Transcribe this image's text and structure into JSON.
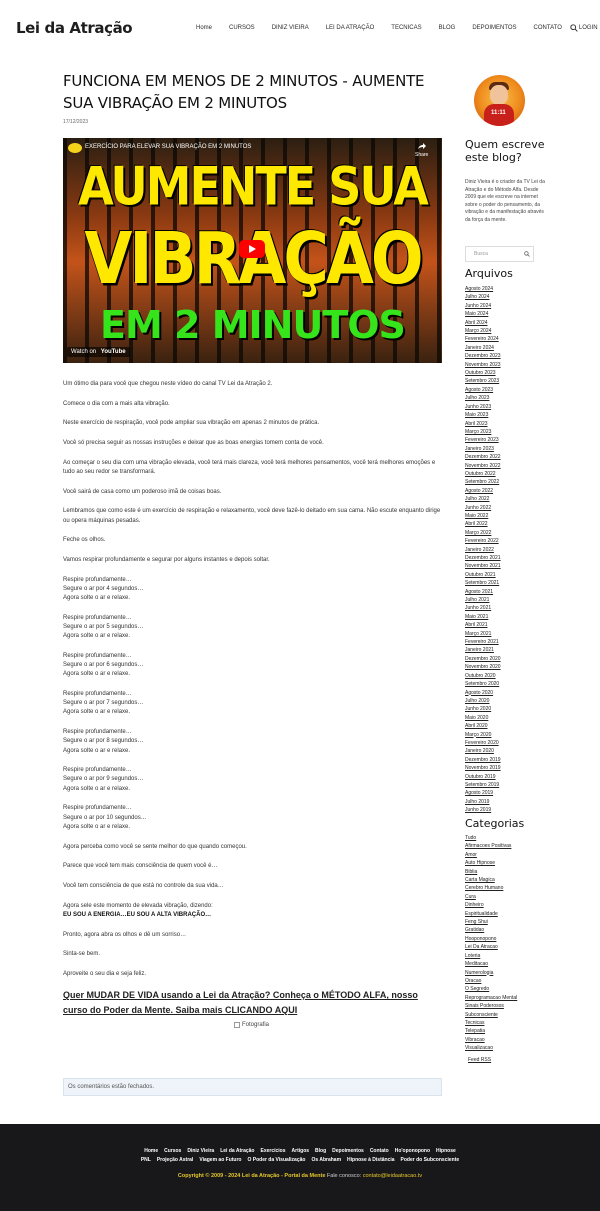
{
  "header": {
    "logo": "Lei da Atração",
    "nav": [
      "Home",
      "CURSOS",
      "DINIZ VIEIRA",
      "LEI DA ATRAÇÃO",
      "TECNICAS",
      "BLOG",
      "DEPOIMENTOS",
      "CONTATO",
      "LOGIN"
    ]
  },
  "post": {
    "title": "FUNCIONA EM MENOS DE 2 MINUTOS - AUMENTE SUA VIBRAÇÃO EM 2 MINUTOS",
    "date": "17/12/2023",
    "video": {
      "title": "EXERCÍCIO PARA ELEVAR SUA VIBRAÇÃO EM 2 MINUTOS",
      "share": "Share",
      "line1": "AUMENTE SUA",
      "line2": "VIBRAÇÃO",
      "line3": "EM 2 MINUTOS",
      "watch_on": "Watch on",
      "youtube": "YouTube"
    },
    "paragraphs": [
      "Um ótimo dia para você que chegou neste vídeo do canal TV Lei da Atração 2.",
      "Comece o dia com a mais alta vibração.",
      "Neste exercício de respiração, você pode ampliar sua vibração em apenas 2 minutos de prática.",
      "Você só precisa seguir as nossas instruções e deixar que as boas energias tomem conta de você.",
      "Ao começar o seu dia com uma vibração elevada, você terá mais clareza, você terá melhores pensamentos, você terá melhores emoções e tudo ao seu redor se transformará.",
      "Você sairá de casa como um poderoso imã de coisas boas.",
      "Lembramos que como este é um exercício de respiração e relaxamento, você deve fazê-lo deitado em sua cama. Não escute enquanto dirige ou opera máquinas pesadas.",
      "Feche os olhos.",
      "Vamos respirar profundamente e segurar por alguns instantes e depois soltar."
    ],
    "breath_blocks": [
      [
        "Respire profundamente…",
        "Segure o ar por 4 segundos…",
        "Agora solte o ar e relaxe."
      ],
      [
        "Respire profundamente…",
        "Segure o ar por 5 segundos…",
        "Agora solte o ar e relaxe."
      ],
      [
        "Respire profundamente…",
        "Segure o ar por 6 segundos…",
        "Agora solte o ar e relaxe."
      ],
      [
        "Respire profundamente…",
        "Segure o ar por 7 segundos…",
        "Agora solte o ar e relaxe."
      ],
      [
        "Respire profundamente…",
        "Segure o ar por 8 segundos…",
        "Agora solte o ar e relaxe."
      ],
      [
        "Respire profundamente…",
        "Segure o ar por 9 segundos…",
        "Agora solte o ar e relaxe."
      ],
      [
        "Respire profundamente…",
        "Segure o ar por 10 segundos…",
        "Agora solte o ar e relaxe."
      ]
    ],
    "closing": [
      "Agora perceba como você se sente melhor do que quando começou.",
      "Parece que você tem mais consciência de quem você é…",
      "Você tem consciência de que está no controle da sua vida…"
    ],
    "repeat_intro": "Agora sele este momento de elevada vibração, dizendo:",
    "repeat_bold": "EU SOU A ENERGIA…EU SOU A ALTA VIBRAÇÃO…",
    "final": [
      "Pronto, agora abra os olhos e dê um sorriso…",
      "Sinta-se bem.",
      "Aproveite o seu dia e seja feliz."
    ],
    "cta": "Quer MUDAR DE VIDA usando a Lei da Atração? Conheça o MÉTODO ALFA, nosso curso do Poder da Mente. Saiba mais CLICANDO AQUI",
    "photo_alt": "Fotografia",
    "comments_closed": "Os comentários estão fechados."
  },
  "sidebar": {
    "avatar_tag": "11:11",
    "about_heading": "Quem escreve este blog?",
    "about_text": "Diniz Vieira é o criador da TV Lei da Atração e do Método Alfa. Desde 2009 que ele escreve na internet sobre o poder do pensamento, da vibração e da manifestação através da força da mente.",
    "search_placeholder": "Busca",
    "archives_heading": "Arquivos",
    "archives": [
      "Agosto 2024",
      "Julho 2024",
      "Junho 2024",
      "Maio 2024",
      "Abril 2024",
      "Março 2024",
      "Fevereiro 2024",
      "Janeiro 2024",
      "Dezembro 2023",
      "Novembro 2023",
      "Outubro 2023",
      "Setembro 2023",
      "Agosto 2023",
      "Julho 2023",
      "Junho 2023",
      "Maio 2023",
      "Abril 2023",
      "Março 2023",
      "Fevereiro 2023",
      "Janeiro 2023",
      "Dezembro 2022",
      "Novembro 2022",
      "Outubro 2022",
      "Setembro 2022",
      "Agosto 2022",
      "Julho 2022",
      "Junho 2022",
      "Maio 2022",
      "Abril 2022",
      "Março 2022",
      "Fevereiro 2022",
      "Janeiro 2022",
      "Dezembro 2021",
      "Novembro 2021",
      "Outubro 2021",
      "Setembro 2021",
      "Agosto 2021",
      "Julho 2021",
      "Junho 2021",
      "Maio 2021",
      "Abril 2021",
      "Março 2021",
      "Fevereiro 2021",
      "Janeiro 2021",
      "Dezembro 2020",
      "Novembro 2020",
      "Outubro 2020",
      "Setembro 2020",
      "Agosto 2020",
      "Julho 2020",
      "Junho 2020",
      "Maio 2020",
      "Abril 2020",
      "Março 2020",
      "Fevereiro 2020",
      "Janeiro 2020",
      "Dezembro 2019",
      "Novembro 2019",
      "Outubro 2019",
      "Setembro 2019",
      "Agosto 2019",
      "Julho 2019",
      "Junho 2019"
    ],
    "categories_heading": "Categorias",
    "categories": [
      "Tudo",
      "Afirmacoes Positivas",
      "Amor",
      "Auto Hipnose",
      "Biblia",
      "Carta Magica",
      "Cerebro Humano",
      "Cura",
      "Dinheiro",
      "Espiritualidade",
      "Feng Shui",
      "Gratidao",
      "Hooponopono",
      "Lei Da Atracao",
      "Loteria",
      "Meditacao",
      "Numerologia",
      "Oracao",
      "O Segredo",
      "Reprogramacao Mental",
      "Sinais Poderosos",
      "Subconsciente",
      "Tecnicas",
      "Telepatia",
      "Vibracao",
      "Visualizacao"
    ],
    "feed": "Feed RSS"
  },
  "footer": {
    "row1": [
      "Home",
      "Cursos",
      "Diniz Vieira",
      "Lei da Atração",
      "Exercícios",
      "Artigos",
      "Blog",
      "Depoimentos",
      "Contato",
      "Ho'oponopono",
      "Hipnose"
    ],
    "row2": [
      "PNL",
      "Projeção Astral",
      "Viagem ao Futuro",
      "O Poder da Visualização",
      "Os Abraham",
      "Hipnose à Distância",
      "Poder do Subconsciente"
    ],
    "copyright": "Copyright © 2009 - 2024 Lei da Atração - Portal da Mente",
    "contact_label": "Fale conosco:",
    "email": "contato@leidaatracao.tv"
  },
  "colors": {
    "footer_bg": "#18181b",
    "footer_accent": "#e6c82a",
    "video_headline": "#ffe800",
    "video_subline": "#36e41c",
    "youtube_red": "#ff0000",
    "comments_bg": "#eef4fa"
  },
  "icons": {
    "header_search": "search-icon",
    "sidebar_search": "search-icon",
    "video_play": "play-icon"
  }
}
